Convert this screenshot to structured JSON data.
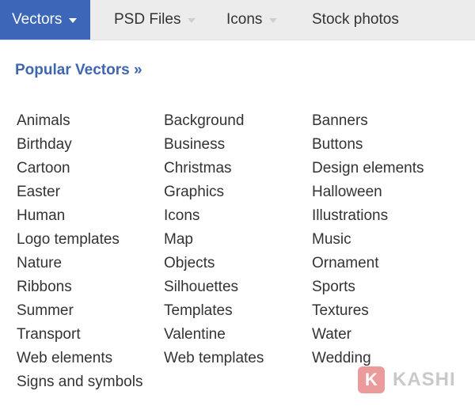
{
  "nav": {
    "tabs": [
      {
        "label": "Vectors"
      },
      {
        "label": "PSD Files"
      },
      {
        "label": "Icons"
      },
      {
        "label": "Stock photos"
      }
    ]
  },
  "popular_link": "Popular Vectors »",
  "categories": {
    "col1": [
      "Animals",
      "Birthday",
      "Cartoon",
      "Easter",
      "Human",
      "Logo templates",
      "Nature",
      "Ribbons",
      "Summer",
      "Transport",
      "Web elements",
      "Signs and symbols"
    ],
    "col2": [
      "Background",
      "Business",
      "Christmas",
      "Graphics",
      "Icons",
      "Map",
      "Objects",
      "Silhouettes",
      "Templates",
      "Valentine",
      "Web templates"
    ],
    "col3": [
      "Banners",
      "Buttons",
      "Design elements",
      "Halloween",
      "Illustrations",
      "Music",
      "Ornament",
      "Sports",
      "Textures",
      "Water",
      "Wedding"
    ]
  },
  "watermark": {
    "letter": "K",
    "text": "KASHI"
  },
  "colors": {
    "active_tab": "#3c66b8",
    "link": "#3f66ae",
    "nav_bg": "#ececec",
    "text": "#333333"
  }
}
